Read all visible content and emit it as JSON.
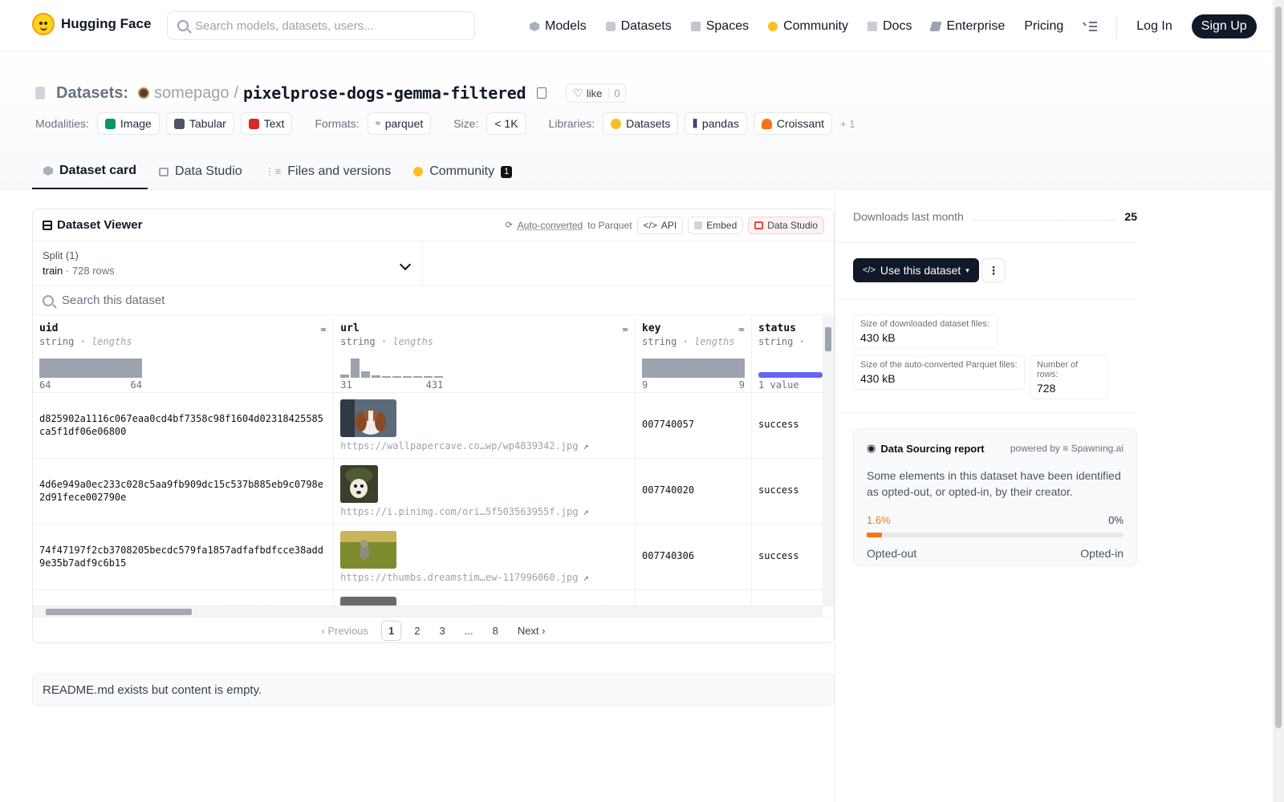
{
  "nav": {
    "brand": "Hugging Face",
    "search_placeholder": "Search models, datasets, users...",
    "links": [
      "Models",
      "Datasets",
      "Spaces",
      "Community",
      "Docs",
      "Enterprise",
      "Pricing"
    ],
    "login": "Log In",
    "signup": "Sign Up"
  },
  "header": {
    "section_label": "Datasets:",
    "owner": "somepago",
    "separator": "/",
    "dataset_name": "pixelprose-dogs-gemma-filtered",
    "like_label": "like",
    "like_count": "0",
    "modalities_label": "Modalities:",
    "modalities": [
      "Image",
      "Tabular",
      "Text"
    ],
    "formats_label": "Formats:",
    "formats": [
      "parquet"
    ],
    "size_label": "Size:",
    "size": "< 1K",
    "libraries_label": "Libraries:",
    "libraries": [
      "Datasets",
      "pandas",
      "Croissant"
    ],
    "more_libraries": "+ 1"
  },
  "tabs": [
    {
      "label": "Dataset card",
      "active": true
    },
    {
      "label": "Data Studio"
    },
    {
      "label": "Files and versions"
    },
    {
      "label": "Community",
      "badge": "1"
    }
  ],
  "viewer": {
    "title": "Dataset Viewer",
    "auto_converted": "Auto-converted",
    "to_parquet": "to Parquet",
    "api": "API",
    "embed": "Embed",
    "data_studio": "Data Studio",
    "split_label": "Split (1)",
    "split_name": "train",
    "split_dot": "·",
    "split_rows": "728 rows",
    "search_placeholder": "Search this dataset",
    "columns": [
      {
        "name": "uid",
        "type": "string",
        "stat": "lengths",
        "min": "64",
        "max": "64"
      },
      {
        "name": "url",
        "type": "string",
        "stat": "lengths",
        "min": "31",
        "max": "431"
      },
      {
        "name": "key",
        "type": "string",
        "stat": "lengths",
        "min": "9",
        "max": "9"
      },
      {
        "name": "status",
        "type": "string",
        "stat": "",
        "min": "1 value",
        "max": ""
      }
    ],
    "url_histogram": [
      0.18,
      1.0,
      0.35,
      0.14,
      0.06,
      0.06,
      0.06,
      0.06,
      0.06,
      0.06
    ],
    "rows": [
      {
        "uid": "d825902a1116c067eaa0cd4bf7358c98f1604d02318425585ca5f1df06e06800",
        "url": "https://wallpapercave.co…wp/wp4839342.jpg",
        "key": "007740057",
        "status": "success"
      },
      {
        "uid": "4d6e949a0ec233c028c5aa9fb909dc15c537b885eb9c0798e2d91fece002790e",
        "url": "https://i.pinimg.com/ori…5f503563955f.jpg",
        "key": "007740020",
        "status": "success"
      },
      {
        "uid": "74f47197f2cb3708205becdc579fa1857adfafbdfcce38add9e35b7adf9c6b15",
        "url": "https://thumbs.dreamstim…ew-117996060.jpg",
        "key": "007740306",
        "status": "success"
      }
    ],
    "pager": {
      "prev": "Previous",
      "pages": [
        "1",
        "2",
        "3",
        "...",
        "8"
      ],
      "current": "1",
      "next": "Next"
    }
  },
  "readme_notice": "README.md exists but content is empty.",
  "side": {
    "downloads_label": "Downloads last month",
    "downloads": "25",
    "use_button": "Use this dataset",
    "stat1_label": "Size of downloaded dataset files:",
    "stat1_value": "430 kB",
    "stat2_label": "Size of the auto-converted Parquet files:",
    "stat2_value": "430 kB",
    "stat3_label": "Number of rows:",
    "stat3_value": "728",
    "report_title": "Data Sourcing report",
    "powered_by": "powered by",
    "powered_name": "Spawning.ai",
    "report_text": "Some elements in this dataset have been identified as opted-out, or opted-in, by their creator.",
    "opted_out_pct": "1.6%",
    "opted_in_pct": "0%",
    "opted_out_fraction": 0.016,
    "opted_out_label": "Opted-out",
    "opted_in_label": "Opted-in"
  },
  "colors": {
    "accent_orange": "#f97316",
    "dark": "#111827",
    "muted": "#6b7280"
  }
}
